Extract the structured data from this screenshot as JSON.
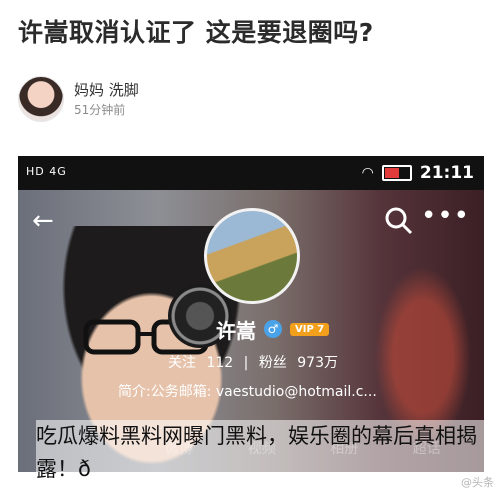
{
  "article": {
    "headline": "许嵩取消认证了 这是要退圈吗?"
  },
  "author": {
    "name": "妈妈 洗脚",
    "time": "51分钟前"
  },
  "screenshot": {
    "status_left": "HD 4G",
    "time": "21:11",
    "profile": {
      "name": "许嵩",
      "vip": "VIP 7",
      "follow_label": "关注",
      "follow_count": "112",
      "fans_label": "粉丝",
      "fans_count": "973万",
      "bio": "简介:公务邮箱: vaestudio@hotmail.c..."
    },
    "tabs": [
      "微博",
      "视频",
      "相册",
      "超话"
    ]
  },
  "caption": "吃瓜爆料黑料网曝门黑料，娱乐圈的幕后真相揭露！ð",
  "watermark": "@头条"
}
